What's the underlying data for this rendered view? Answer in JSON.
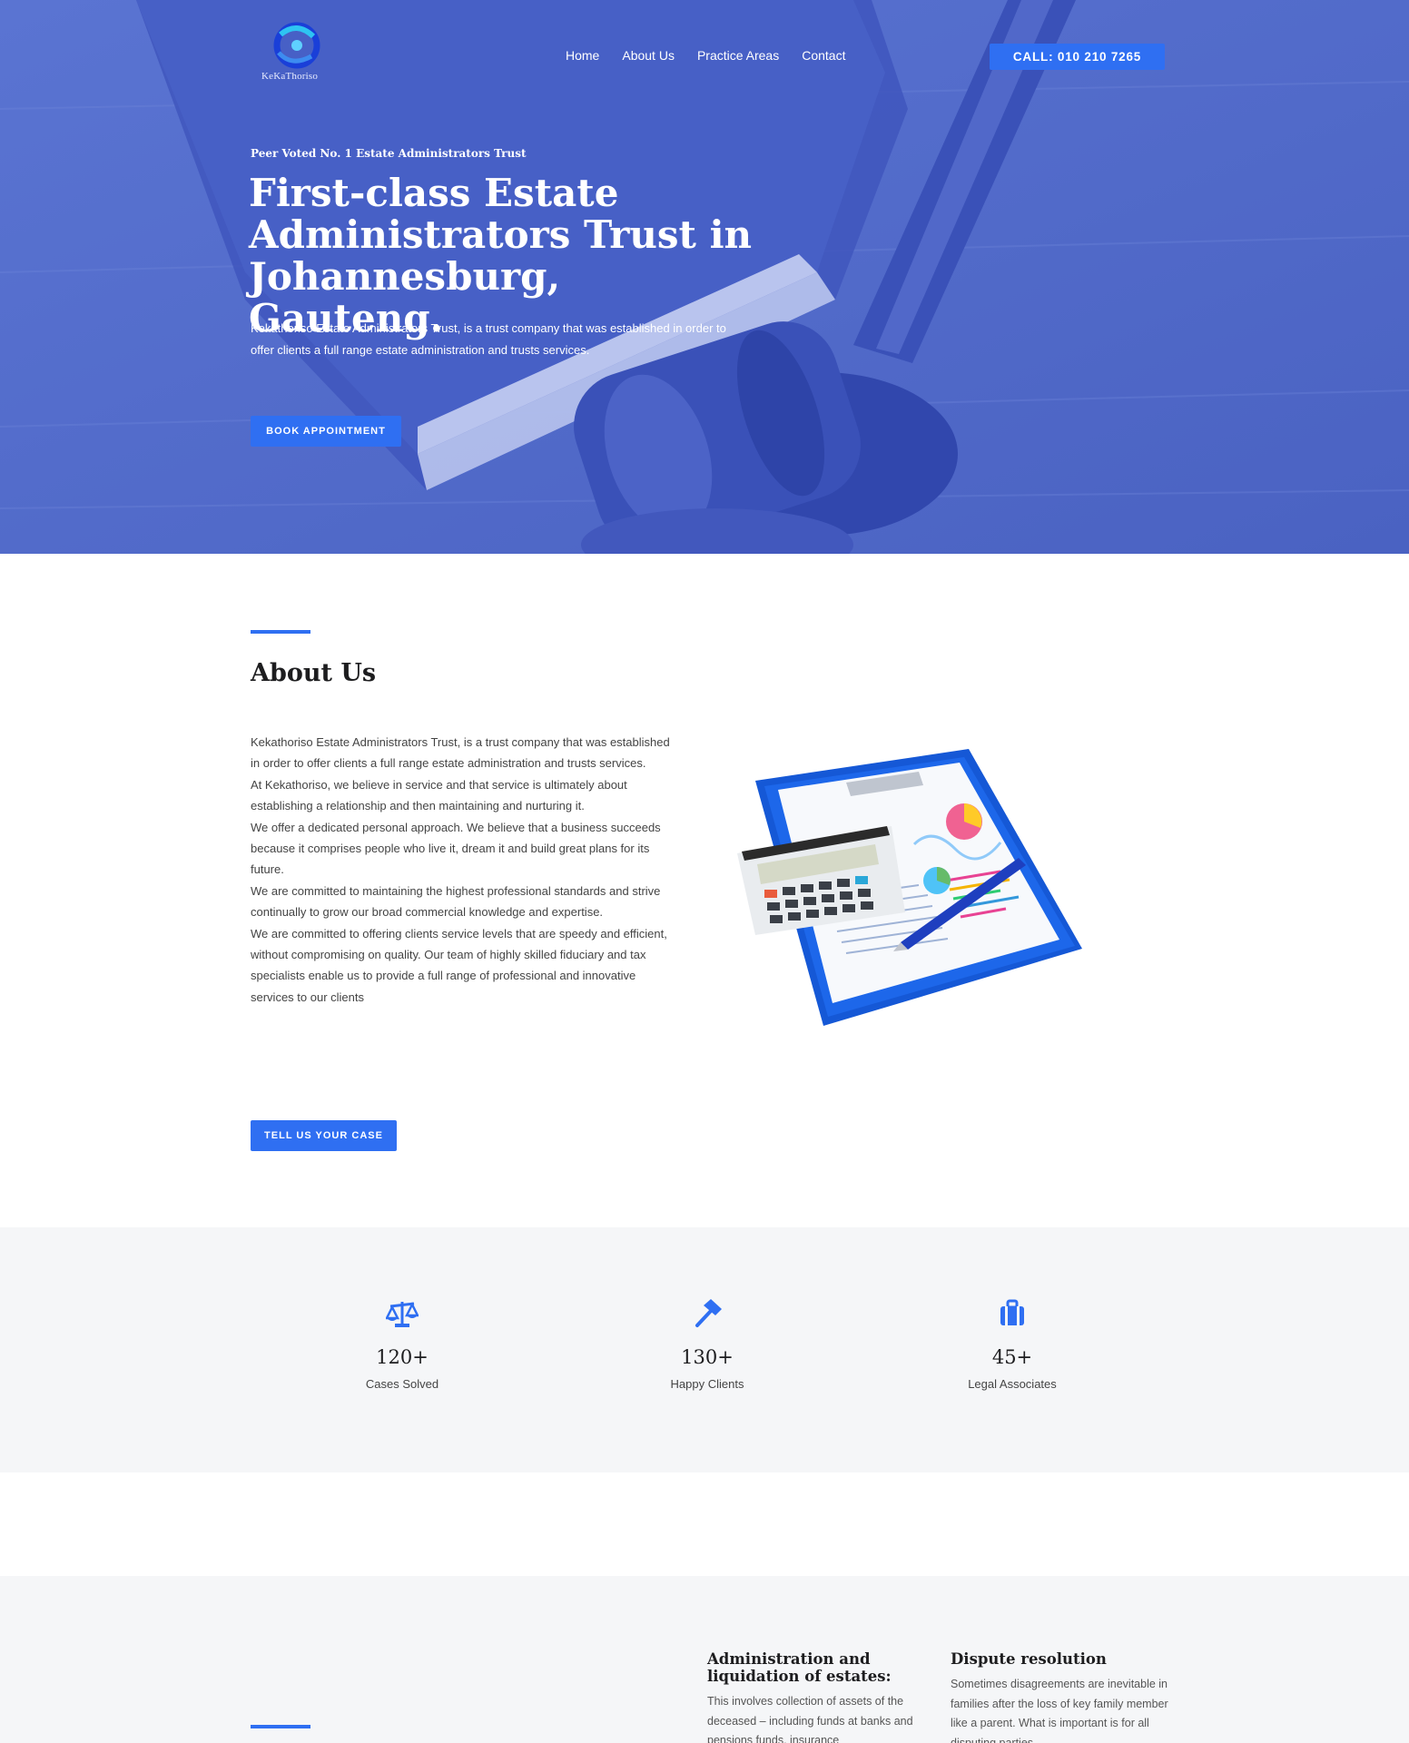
{
  "header": {
    "logo_text": "KeKaThoriso",
    "nav": [
      "Home",
      "About Us",
      "Practice Areas",
      "Contact"
    ],
    "call_label": "CALL: 010 210 7265"
  },
  "hero": {
    "eyebrow": "Peer Voted No. 1 Estate Administrators Trust",
    "title": "First-class Estate Administrators Trust in Johannesburg, Gauteng.",
    "description": "Kekathoriso Estate Administrators Trust, is a trust company that was established in order to offer clients a full range estate administration and trusts services.",
    "button": "BOOK APPOINTMENT"
  },
  "about": {
    "title": "About Us",
    "paragraphs": [
      "Kekathoriso Estate Administrators Trust, is a trust company that was established in order to offer clients a full range estate administration and trusts services.",
      "At Kekathoriso, we believe in service and that service is ultimately about establishing a relationship and then maintaining and nurturing it.",
      "We offer a dedicated personal approach. We believe that a business succeeds because it comprises people who live it, dream it and build great plans for its future.",
      "We are committed to maintaining the highest professional standards and strive continually to grow our broad commercial knowledge and expertise.",
      "We are committed to offering clients service levels that are speedy and efficient, without compromising on quality. Our team of highly skilled fiduciary and tax specialists enable us to provide a full range of professional and innovative services to our clients"
    ],
    "button": "TELL US YOUR CASE"
  },
  "stats": [
    {
      "icon": "scales-icon",
      "value": "120+",
      "label": "Cases Solved"
    },
    {
      "icon": "hammer-icon",
      "value": "130+",
      "label": "Happy Clients"
    },
    {
      "icon": "briefcase-icon",
      "value": "45+",
      "label": "Legal Associates"
    }
  ],
  "practice": [
    {
      "title": "Administration and liquidation of estates:",
      "text": "This involves collection of assets of the deceased – including funds at banks and pensions funds, insurance"
    },
    {
      "title": "Dispute resolution",
      "text": "Sometimes disagreements are inevitable in families after the loss of key family member like a parent. What is important is for all disputing parties"
    }
  ],
  "colors": {
    "accent": "#2f6ff2",
    "hero_overlay": "#5268c6",
    "section_bg": "#f5f6f8"
  }
}
